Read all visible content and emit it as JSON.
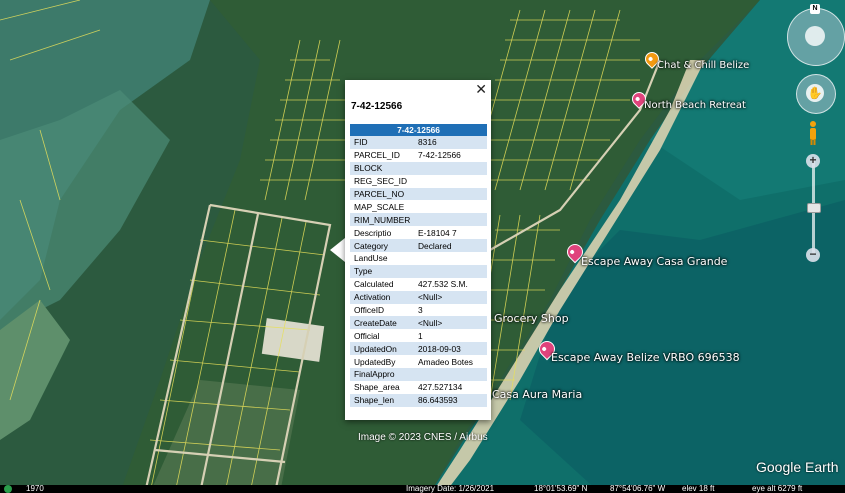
{
  "popup": {
    "title": "7-42-12566",
    "header": "7-42-12566",
    "close_glyph": "✕",
    "rows": [
      {
        "field": "FID",
        "value": "8316"
      },
      {
        "field": "PARCEL_ID",
        "value": "7-42-12566"
      },
      {
        "field": "BLOCK",
        "value": ""
      },
      {
        "field": "REG_SEC_ID",
        "value": ""
      },
      {
        "field": "PARCEL_NO",
        "value": ""
      },
      {
        "field": "MAP_SCALE",
        "value": ""
      },
      {
        "field": "RIM_NUMBER",
        "value": ""
      },
      {
        "field": "Descriptio",
        "value": "E-18104 7"
      },
      {
        "field": "Category",
        "value": "Declared"
      },
      {
        "field": "LandUse",
        "value": ""
      },
      {
        "field": "Type",
        "value": ""
      },
      {
        "field": "Calculated",
        "value": "427.532 S.M."
      },
      {
        "field": "Activation",
        "value": "<Null>"
      },
      {
        "field": "OfficeID",
        "value": "3"
      },
      {
        "field": "CreateDate",
        "value": "<Null>"
      },
      {
        "field": "Official",
        "value": "1"
      },
      {
        "field": "UpdatedOn",
        "value": "2018-09-03"
      },
      {
        "field": "UpdatedBy",
        "value": "Amadeo Botes"
      },
      {
        "field": "FinalAppro",
        "value": ""
      },
      {
        "field": "Shape_area",
        "value": "427.527134"
      },
      {
        "field": "Shape_len",
        "value": "86.643593"
      }
    ]
  },
  "places": {
    "chat_chill": "Chat & Chill Belize",
    "north_beach": "North Beach Retreat",
    "casa_grande": "Escape Away Casa Grande",
    "grocery": "Grocery Shop",
    "vrbo": "Escape Away Belize VRBO 696538",
    "casa_aura": "Casa Aura Maria"
  },
  "pin_colors": {
    "orange": "#f29a12",
    "pink": "#e0437c"
  },
  "nav": {
    "compass_label": "N",
    "zoom_in": "+",
    "zoom_out": "−",
    "pan_glyph": "✋"
  },
  "attribution": "Image © 2023 CNES / Airbus",
  "logo": "Google Earth",
  "status": {
    "historical_year": "1970",
    "imagery_date": "Imagery Date: 1/26/2021",
    "lat": "18°01'53.69\" N",
    "lon": "87°54'06.76\" W",
    "elev": "elev   18 ft",
    "eye_alt": "eye alt  6279 ft"
  },
  "colors": {
    "popup_header": "#1f6fb6",
    "row_alt": "#d6e4f2",
    "parcel_lines": "#e8e05a"
  }
}
